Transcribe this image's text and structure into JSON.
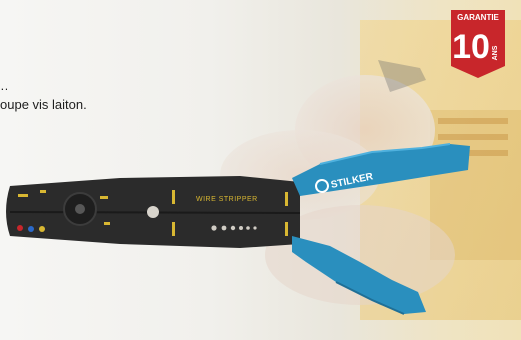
{
  "description_lines": [
    "…",
    "oupe vis laiton."
  ],
  "badge": {
    "top_label": "GARANTIE",
    "number": "10",
    "unit": "ANS"
  },
  "tool": {
    "brand": "STILKER",
    "stripper_label": "WIRE STRIPPER",
    "handle_color": "#2a8fbe",
    "body_color": "#2b2b2b",
    "markings_color": "#d8b732"
  },
  "accent_red": "#c8262b"
}
